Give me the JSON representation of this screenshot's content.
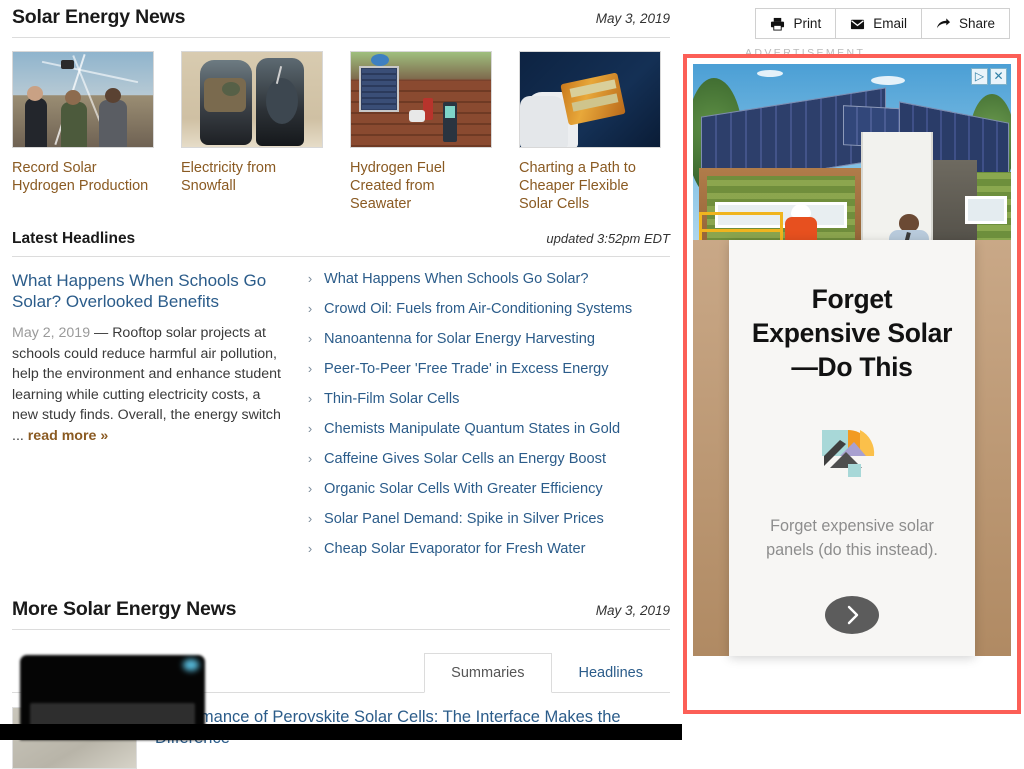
{
  "header": {
    "title": "Solar Energy News",
    "date": "May 3, 2019",
    "toolbar": [
      {
        "label": "Print",
        "icon": "printer-icon"
      },
      {
        "label": "Email",
        "icon": "envelope-icon"
      },
      {
        "label": "Share",
        "icon": "share-arrow-icon"
      }
    ]
  },
  "featured_thumbs": [
    {
      "caption": "Record Solar Hydrogen Production",
      "image_alt": "three-people-looking-up-at-solar-dish"
    },
    {
      "caption": "Electricity from Snowfall",
      "image_alt": "backpack-with-solar-device"
    },
    {
      "caption": "Hydrogen Fuel Created from Seawater",
      "image_alt": "hand-holding-solar-panel-on-picnic-table"
    },
    {
      "caption": "Charting a Path to Cheaper Flexible Solar Cells",
      "image_alt": "gloved-hand-holding-flexible-gold-solar-cell"
    }
  ],
  "latest": {
    "title": "Latest Headlines",
    "updated": "updated 3:52pm EDT",
    "feature": {
      "title": "What Happens When Schools Go Solar? Overlooked Benefits",
      "date": "May 2, 2019",
      "dash": "—",
      "body": "Rooftop solar projects at schools could reduce harmful air pollution, help the environment and enhance student learning while cutting electricity costs, a new study finds. Overall, the energy switch ...",
      "read_more": "read more »"
    },
    "headlines": [
      "What Happens When Schools Go Solar?",
      "Crowd Oil: Fuels from Air-Conditioning Systems",
      "Nanoantenna for Solar Energy Harvesting",
      "Peer-To-Peer 'Free Trade' in Excess Energy",
      "Thin-Film Solar Cells",
      "Chemists Manipulate Quantum States in Gold",
      "Caffeine Gives Solar Cells an Energy Boost",
      "Organic Solar Cells With Greater Efficiency",
      "Solar Panel Demand: Spike in Silver Prices",
      "Cheap Solar Evaporator for Fresh Water"
    ]
  },
  "more": {
    "title": "More Solar Energy News",
    "date": "May 3, 2019",
    "tabs": [
      {
        "label": "Summaries",
        "active": true
      },
      {
        "label": "Headlines",
        "active": false
      }
    ],
    "items": [
      {
        "title": "Performance of Perovskite Solar Cells: The Interface Makes the Difference"
      }
    ]
  },
  "ad": {
    "label": "ADVERTISEMENT",
    "adchoices_info": "▷",
    "adchoices_close": "✕",
    "hero_alt": "modern-solar-house-with-green-walls-and-workers",
    "headline_lines": [
      "Forget",
      "Expensive Solar",
      "—Do This"
    ],
    "body": "Forget expensive solar panels (do this instead).",
    "cta_icon": "chevron-right-icon",
    "border_color": "#fc5f57",
    "logo_colors": {
      "teal": "#a8d8d8",
      "orange": "#f29a22",
      "yellow": "#fbc04a",
      "gray": "#4f4f4f",
      "purple": "#a8a0d0"
    }
  }
}
